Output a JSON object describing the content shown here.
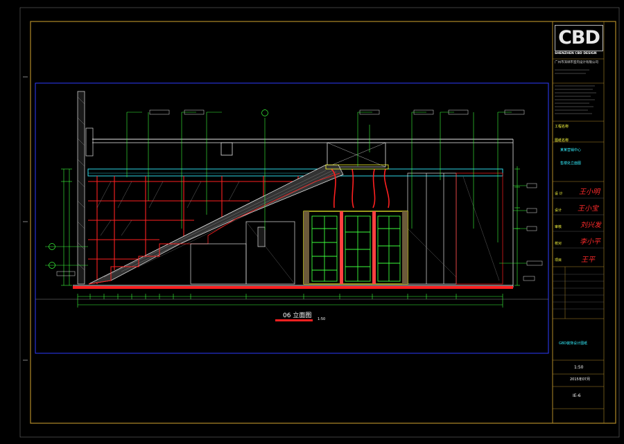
{
  "drawing": {
    "caption": "06 立面图",
    "caption_scale": "1:50"
  },
  "title_block": {
    "logo_text": "CBD",
    "company_en": "SHENZHEN CBD DESIGN",
    "company_cn": "广州市深圳市室内设计有限公司",
    "project_label": "工程名称",
    "project_name": "某某营销中心",
    "drawing_label": "图纸名称",
    "drawing_name": "售楼处立面图",
    "roles": [
      "设 计",
      "设计",
      "审核",
      "校对",
      "项目"
    ],
    "scale": "1:50",
    "date": "2015年07月",
    "drawing_no": "IE-6",
    "footer_label": "GBD装饰设计图纸"
  },
  "signatures": [
    "王小明",
    "王小宝",
    "刘兴发",
    "李小平",
    "王平"
  ],
  "colors": {
    "frame": "#b08a28",
    "border_blue": "#2e3bff",
    "cyan": "#34f0ff",
    "green": "#3cff3c",
    "red": "#ff2020",
    "yellow": "#ffff30",
    "white": "#ffffff"
  }
}
